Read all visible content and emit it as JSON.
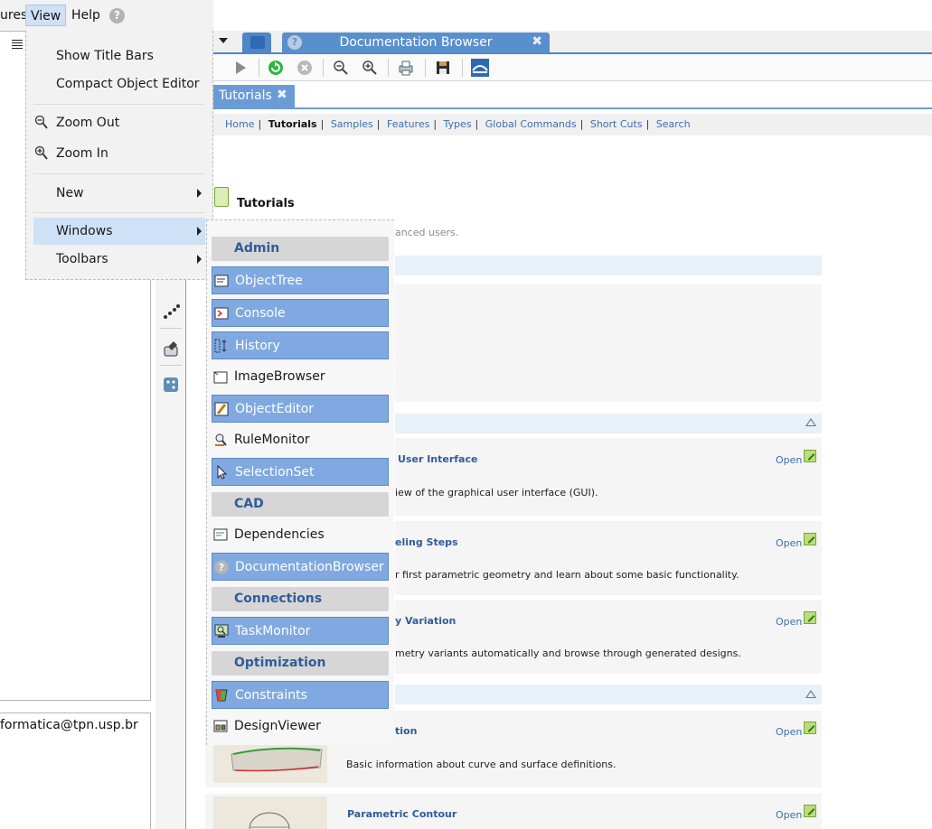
{
  "menubar": {
    "items": [
      "ures",
      "View",
      "Help"
    ],
    "help_icon": "?"
  },
  "left_pane": {
    "email": "formatica@tpn.usp.br"
  },
  "top_tabs": {
    "doc_tab_icon": "?",
    "doc_tab_label": "Documentation Browser",
    "close": "✖"
  },
  "inner_tab": {
    "label": "Tutorials",
    "close": "✖"
  },
  "breadcrumbs": [
    "Home",
    "Tutorials",
    "Samples",
    "Features",
    "Types",
    "Global Commands",
    "Short Cuts",
    "Search"
  ],
  "breadcrumb_separator": "|",
  "content": {
    "title": "Tutorials",
    "subtitle": "anced users.",
    "open_label": "Open",
    "cards": [
      {
        "title": "User Interface",
        "desc": "iew of the graphical user interface (GUI)."
      },
      {
        "title": "eling Steps",
        "desc": "r first parametric geometry and learn about some basic functionality."
      },
      {
        "title": "y Variation",
        "desc": "metry variants automatically and browse through generated designs."
      },
      {
        "title": "tion",
        "desc": "Basic information about curve and surface definitions."
      },
      {
        "title": "Parametric Contour",
        "desc": ""
      }
    ]
  },
  "view_menu": {
    "show_title_bars": "Show Title Bars",
    "compact_object_editor": "Compact Object Editor",
    "zoom_out": "Zoom Out",
    "zoom_in": "Zoom In",
    "new": "New",
    "windows": "Windows",
    "toolbars": "Toolbars"
  },
  "windows_menu": {
    "admin": "Admin",
    "object_tree": "ObjectTree",
    "console": "Console",
    "history": "History",
    "image_browser": "ImageBrowser",
    "object_editor": "ObjectEditor",
    "rule_monitor": "RuleMonitor",
    "selection_set": "SelectionSet",
    "cad": "CAD",
    "dependencies": "Dependencies",
    "documentation_browser": "DocumentationBrowser",
    "connections": "Connections",
    "task_monitor": "TaskMonitor",
    "optimization": "Optimization",
    "constraints": "Constraints",
    "design_viewer": "DesignViewer"
  },
  "colors": {
    "accent": "#4f86c6",
    "selection": "#7fa9e0",
    "link": "#3a6fb0",
    "group_text": "#2f5c9a"
  }
}
